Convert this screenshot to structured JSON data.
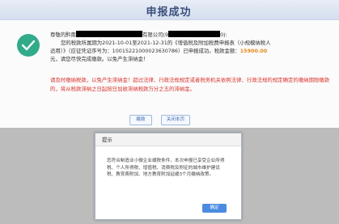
{
  "header": {
    "title": "申报成功"
  },
  "colors": {
    "accent_green": "#31ab8a",
    "warning_red": "#d8332c",
    "amount_orange": "#e58a1a",
    "button_blue": "#4b8ce0"
  },
  "message": {
    "greeting_prefix": "尊敬的黔南",
    "greeting_mid": "有限公司(9",
    "greeting_suffix": "0):",
    "line2": "您的税款所属期为2021-10-01至2021-12-31的《增值税及附加税费申报表（小规模纳税人",
    "line3": "适用）》（应征凭证序号为：10015221000023630786）已申报成功。税款金额：",
    "amount": "15900.00",
    "line3_tail": "元，请您尽快完成缴款。以免产生滞纳金！",
    "warning": "请及时缴纳税款，以免产生滞纳金！超过法律、行政法规规定或者税务机关依照法律、行政法规的规定确定的缴纳期限缴款的，将从税款滞纳之日起按日加收滞纳税款万分之五的滞纳金。"
  },
  "buttons": {
    "pay": "缴款",
    "close_page": "关闭本页"
  },
  "dialog": {
    "title": "提示",
    "body": "您符合制造业小微企业缓税条件，本次申报已享受企业所得税、个人所得税、增值税、消费税及附征的城市维护建设税、教育费附加、地方教育附加延缓3个月缴纳政策。",
    "ok": "确定"
  }
}
